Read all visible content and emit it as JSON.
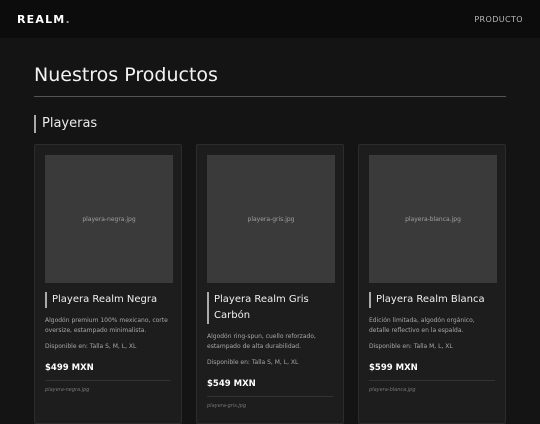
{
  "header": {
    "logo": "REALM",
    "logo_dot": ".",
    "nav_link": "PRODUCTO"
  },
  "main": {
    "title": "Nuestros Productos",
    "section": "Playeras",
    "products": [
      {
        "image_label": "playera-negra.jpg",
        "name": "Playera Realm Negra",
        "description": "Algodón premium 100% mexicano, corte oversize, estampado minimalista.",
        "sizes": "Disponible en: Talla S, M, L, XL",
        "price": "$499 MXN",
        "file": "playera-negra.jpg"
      },
      {
        "image_label": "playera-gris.jpg",
        "name": "Playera Realm Gris Carbón",
        "description": "Algodón ring-spun, cuello reforzado, estampado de alta durabilidad.",
        "sizes": "Disponible en: Talla S, M, L, XL",
        "price": "$549 MXN",
        "file": "playera-gris.jpg"
      },
      {
        "image_label": "playera-blanca.jpg",
        "name": "Playera Realm Blanca",
        "description": "Edición limitada, algodón orgánico, detalle reflectivo en la espalda.",
        "sizes": "Disponible en: Talla M, L, XL",
        "price": "$599 MXN",
        "file": "playera-blanca.jpg"
      }
    ]
  }
}
